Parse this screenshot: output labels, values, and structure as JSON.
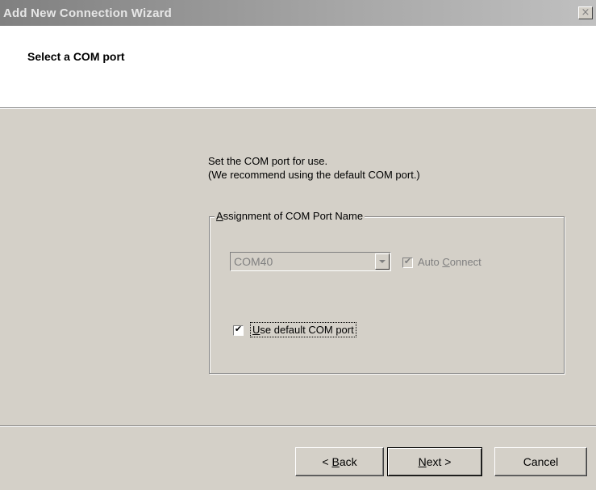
{
  "window": {
    "title": "Add New Connection Wizard",
    "close_glyph": "×"
  },
  "header": {
    "title": "Select a COM port"
  },
  "body": {
    "instruction_line1": "Set the COM port for use.",
    "instruction_line2": "(We recommend using the default COM port.)"
  },
  "group": {
    "legend_accel": "A",
    "legend_rest": "ssignment of COM Port Name",
    "combo_value": "COM40",
    "combo_disabled": true,
    "auto_connect_pre": "Auto ",
    "auto_connect_accel": "C",
    "auto_connect_rest": "onnect",
    "auto_connect_checked": true,
    "auto_connect_disabled": true,
    "default_port_accel": "U",
    "default_port_rest": "se default COM port",
    "default_port_checked": true
  },
  "buttons": {
    "back_pre": "< ",
    "back_accel": "B",
    "back_rest": "ack",
    "next_accel": "N",
    "next_rest": "ext >",
    "cancel": "Cancel"
  },
  "icons": {
    "check": "✔",
    "close": "close-icon",
    "dropdown": "chevron-down-icon"
  }
}
